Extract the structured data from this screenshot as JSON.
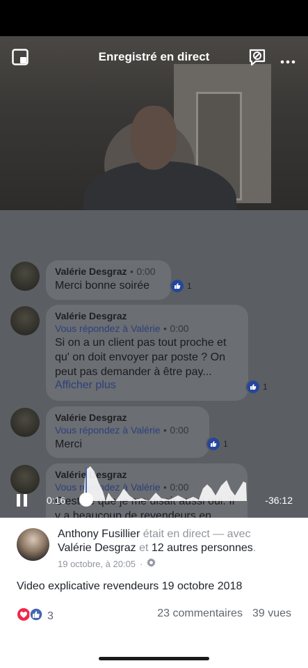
{
  "header": {
    "title": "Enregistré en direct",
    "left_icon": "picture-in-picture-icon",
    "right_icons": [
      "comments-off-icon",
      "more-icon"
    ]
  },
  "comments": [
    {
      "author": "Valérie Desgraz",
      "time": "0:00",
      "reply_to": "",
      "text": "Merci bonne soirée",
      "likes": "1"
    },
    {
      "author": "Valérie Desgraz",
      "time": "0:00",
      "reply_to": "Vous répondez à Valérie",
      "text": "Si on a un client pas tout proche et qu' on doit envoyer par poste ? On peut pas demander à être pay...",
      "more": "Afficher plus",
      "likes": "1"
    },
    {
      "author": "Valérie Desgraz",
      "time": "0:00",
      "reply_to": "Vous répondez à Valérie",
      "text": "Merci",
      "likes": "1"
    },
    {
      "author": "Valérie Desgraz",
      "time": "0:00",
      "reply_to": "Vous répondez à Valérie",
      "text": "C'est ce que je me disait aussi oui. Il y a beaucoup de revendeurs en",
      "likes": ""
    }
  ],
  "player": {
    "current_time": "0:16",
    "remaining_time": "-36:12",
    "progress": 0.007
  },
  "post": {
    "author": "Anthony Fusillier",
    "live_text": "était en direct — avec",
    "with_name": "Valérie Desgraz",
    "and_text": "et",
    "others": "12 autres personnes",
    "period": ".",
    "date": "19 octobre, à 20:05",
    "dot": "·",
    "privacy_icon": "gear-icon",
    "description": "Video explicative revendeurs 19 octobre 2018",
    "reaction_count": "3",
    "comments": "23 commentaires",
    "views": "39 vues"
  },
  "colors": {
    "like_blue": "#4267b2",
    "love_red": "#f0284a",
    "link_blue": "#4267b2"
  }
}
